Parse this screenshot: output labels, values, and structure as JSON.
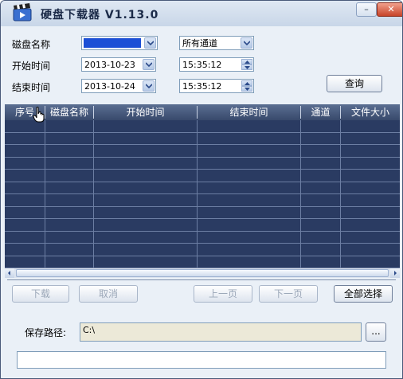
{
  "window": {
    "title": "硬盘下载器 V1.13.0",
    "minimize_glyph": "–",
    "maximize_glyph": "□",
    "close_glyph": "✕"
  },
  "filters": {
    "disk_name_label": "磁盘名称",
    "disk_name_value": "",
    "channel_value": "所有通道",
    "start_label": "开始时间",
    "start_date": "2013-10-23",
    "start_time": "15:35:12",
    "end_label": "结束时间",
    "end_date": "2013-10-24",
    "end_time": "15:35:12",
    "query_button": "查询"
  },
  "table": {
    "columns": [
      "序号",
      "磁盘名称",
      "开始时间",
      "结束时间",
      "通道",
      "文件大小"
    ],
    "row_count": 12
  },
  "actions": {
    "download": "下载",
    "cancel": "取消",
    "prev_page": "上一页",
    "next_page": "下一页",
    "select_all": "全部选择"
  },
  "save": {
    "label": "保存路径:",
    "path": "C:\\",
    "browse": "..."
  },
  "status_text": "",
  "colors": {
    "accent": "#2a3b62",
    "selection": "#1c4fd6"
  }
}
